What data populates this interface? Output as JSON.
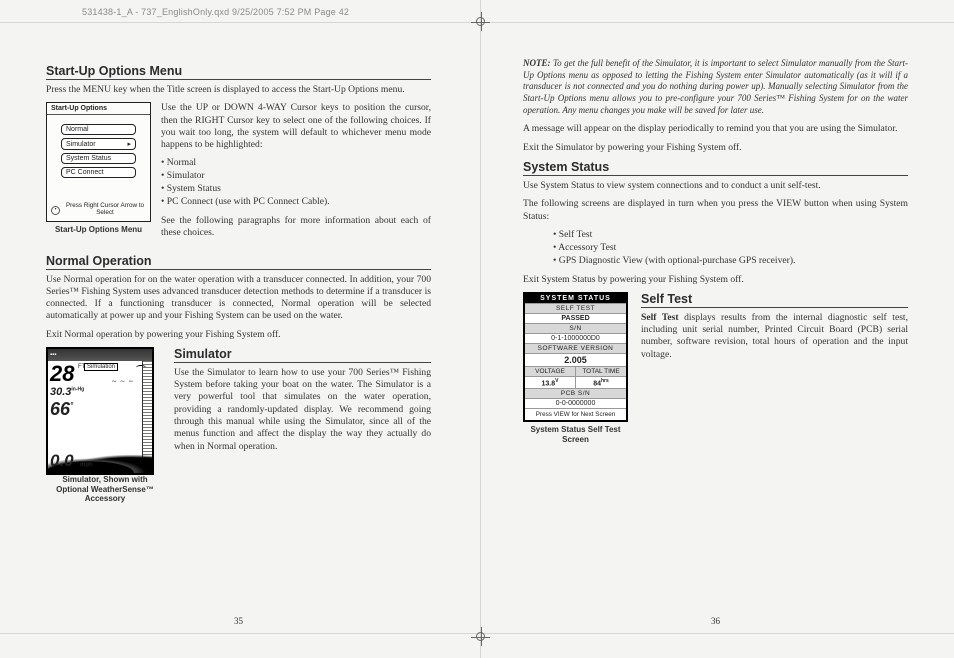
{
  "header_slug": "531438-1_A - 737_EnglishOnly.qxd  9/25/2005  7:52 PM  Page 42",
  "page_left_num": "35",
  "page_right_num": "36",
  "startup": {
    "heading": "Start-Up Options Menu",
    "intro": "Press the MENU key when the Title screen is displayed to access the Start-Up Options menu.",
    "para1": "Use the UP or DOWN 4-WAY Cursor keys to position the cursor, then the RIGHT Cursor key to select one of the following choices. If you wait too long, the system will default to whichever menu mode happens to be highlighted:",
    "bullets": [
      "Normal",
      "Simulator",
      "System Status",
      "PC Connect (use with PC Connect Cable)."
    ],
    "after": "See the following paragraphs for more information about each of these choices.",
    "screen": {
      "title": "Start-Up Options",
      "items": [
        "Normal",
        "Simulator",
        "System Status",
        "PC Connect"
      ],
      "footer": "Press Right Cursor Arrow to Select"
    },
    "caption": "Start-Up Options Menu"
  },
  "normal": {
    "heading": "Normal Operation",
    "para1": "Use Normal operation for on the water operation with a transducer connected. In addition, your 700 Series™ Fishing System uses advanced transducer detection methods to determine if a transducer is connected. If a functioning transducer is connected, Normal operation will be selected automatically at power up and your Fishing System can be used on the water.",
    "para2": "Exit Normal operation by powering your Fishing System off."
  },
  "simulator": {
    "heading": "Simulator",
    "para1": "Use the Simulator to learn how to use your 700 Series™ Fishing System before taking your boat on the water. The Simulator is a very powerful tool that simulates on the water operation, providing a randomly-updated display. We recommend going through this manual while using the Simulator, since all of the menus function and affect the display the way they actually do when in Normal operation.",
    "caption": "Simulator, Shown with Optional WeatherSense™ Accessory",
    "screen": {
      "depth": "28",
      "depth_unit": "FT",
      "tag": "Simulation",
      "line30": "30.3",
      "line30_unit": "in-Hg",
      "temp": "66",
      "temp_unit": "°",
      "speed": "0.0",
      "speed_unit": "mph"
    }
  },
  "note": {
    "label": "NOTE:",
    "text": "To get the full benefit of the Simulator, it is important to select Simulator manually from the Start-Up Options menu as opposed to letting the Fishing System enter Simulator automatically (as it will if a transducer is not connected and you do nothing during power up). Manually selecting Simulator from the Start-Up Options menu allows you to pre-configure your 700 Series™ Fishing System for on the water operation. Any menu changes you make will be saved for later use."
  },
  "message_para": "A message will appear on the display periodically to remind you that you are using the Simulator.",
  "exit_sim": "Exit the Simulator by powering your Fishing System off.",
  "system_status": {
    "heading": "System Status",
    "para1": "Use System Status to view system connections and to conduct a unit self-test.",
    "para2": "The following screens are displayed in turn when you press the VIEW button when using System Status:",
    "bullets": [
      "Self Test",
      "Accessory Test",
      "GPS Diagnostic View  (with optional-purchase GPS receiver)."
    ],
    "exit": "Exit System Status by powering your Fishing System off."
  },
  "self_test": {
    "heading": "Self Test",
    "para1": "Self Test displays results from the internal diagnostic self test, including unit serial number, Printed Circuit Board (PCB) serial number, software revision, total hours of operation and the input voltage.",
    "caption": "System Status Self Test Screen",
    "screen": {
      "title": "SYSTEM STATUS",
      "self_label": "SELF TEST",
      "pass": "PASSED",
      "sn_label": "S/N",
      "sn": "0-1-1000000D0",
      "sw_label": "SOFTWARE VERSION",
      "sw": "2.005",
      "volt_label": "VOLTAGE",
      "time_label": "TOTAL TIME",
      "volt": "13.8",
      "volt_unit": "V",
      "time": "84",
      "time_unit": "hrs",
      "pcb_label": "PCB S/N",
      "pcb": "0-0-0000000",
      "foot": "Press VIEW for Next Screen"
    }
  }
}
